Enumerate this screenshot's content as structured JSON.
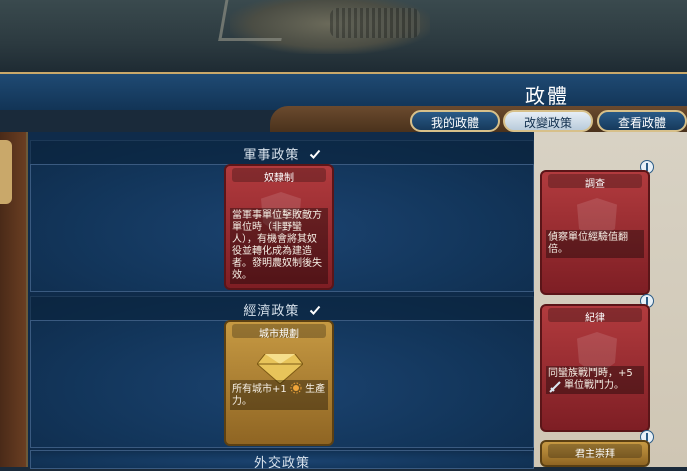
{
  "header": {
    "title": "政體"
  },
  "tabs": [
    {
      "label": "我的政體"
    },
    {
      "label": "改變政策"
    },
    {
      "label": "查看政體"
    }
  ],
  "sections": [
    {
      "title": "軍事政策",
      "card": {
        "name": "奴隸制",
        "description": "當軍事單位擊敗敵方單位時（非野蠻人），有機會將其奴役並轉化成為建造者。發明農奴制後失效。"
      }
    },
    {
      "title": "經濟政策",
      "card": {
        "name": "城市規劃",
        "description_a": "所有城市+1",
        "description_b": "生產力。"
      }
    },
    {
      "title": "外交政策"
    }
  ],
  "available_policies": [
    {
      "name": "調查",
      "description": "偵察單位經驗值翻倍。"
    },
    {
      "name": "紀律",
      "description_a": "同蠻族戰鬥時，+5",
      "description_b": "單位戰鬥力。"
    },
    {
      "name": "君主崇拜"
    }
  ],
  "colors": {
    "military": "#a8323a",
    "economic": "#b8872e",
    "panel_blue": "#12355a"
  }
}
